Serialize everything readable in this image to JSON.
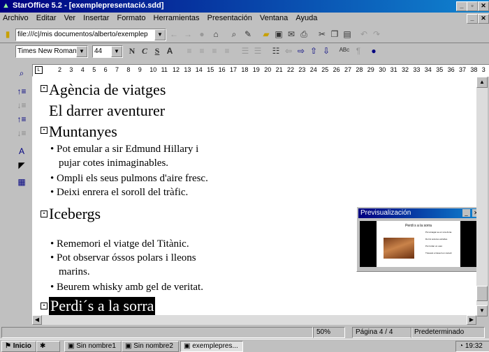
{
  "window": {
    "title": "StarOffice 5.2 - [exemplepresentació.sdd]"
  },
  "menu": [
    "Archivo",
    "Editar",
    "Ver",
    "Insertar",
    "Formato",
    "Herramientas",
    "Presentación",
    "Ventana",
    "Ayuda"
  ],
  "url": {
    "value": "file:///c|/mis documentos/alberto/exemplep"
  },
  "format": {
    "font": "Times New Roman",
    "size": "44",
    "bold": "N",
    "italic": "C",
    "underline": "S"
  },
  "ruler": {
    "ticks": [
      "2",
      "3",
      "4",
      "5",
      "6",
      "7",
      "8",
      "9",
      "10",
      "11",
      "12",
      "13",
      "14",
      "15",
      "16",
      "17",
      "18",
      "19",
      "20",
      "21",
      "22",
      "23",
      "24",
      "25",
      "26",
      "27",
      "28",
      "29",
      "30",
      "31",
      "32",
      "33",
      "34",
      "35",
      "36",
      "37",
      "38",
      "3"
    ]
  },
  "outline": {
    "h1": "Agència de viatges",
    "h1_sub": "El darrer aventurer",
    "h2": "Muntanyes",
    "b1a": "Pot emular a sir Edmund Hillary i",
    "b1b": "pujar cotes inimaginables.",
    "b2": "Ompli els seus pulmons d'aire fresc.",
    "b3": "Deixi enrera el soroll del tràfic.",
    "h3": "Icebergs",
    "b4": "Rememori el viatge del Titànic.",
    "b5a": "Pot observar óssos polars i lleons",
    "b5b": "marins.",
    "b6": "Beurem whisky amb gel de veritat.",
    "h4": "Perdi´s a la sorra"
  },
  "preview": {
    "title": "Previsualización",
    "slide_title": "Perdi s a la sorra",
    "slide_bullets": [
      "Pot amagar-se en una duna.",
      "Dormi sota les estrelles.",
      "Pot trobar un oasi.",
      "Travessi el desert en camell."
    ]
  },
  "status": {
    "zoom": "50%",
    "page": "Página 4 / 4",
    "layout": "Predeterminado"
  },
  "taskbar": {
    "start": "Inicio",
    "t1": "Sin nombre1",
    "t2": "Sin nombre2",
    "t3": "exemplepres...",
    "clock": "19:32"
  }
}
